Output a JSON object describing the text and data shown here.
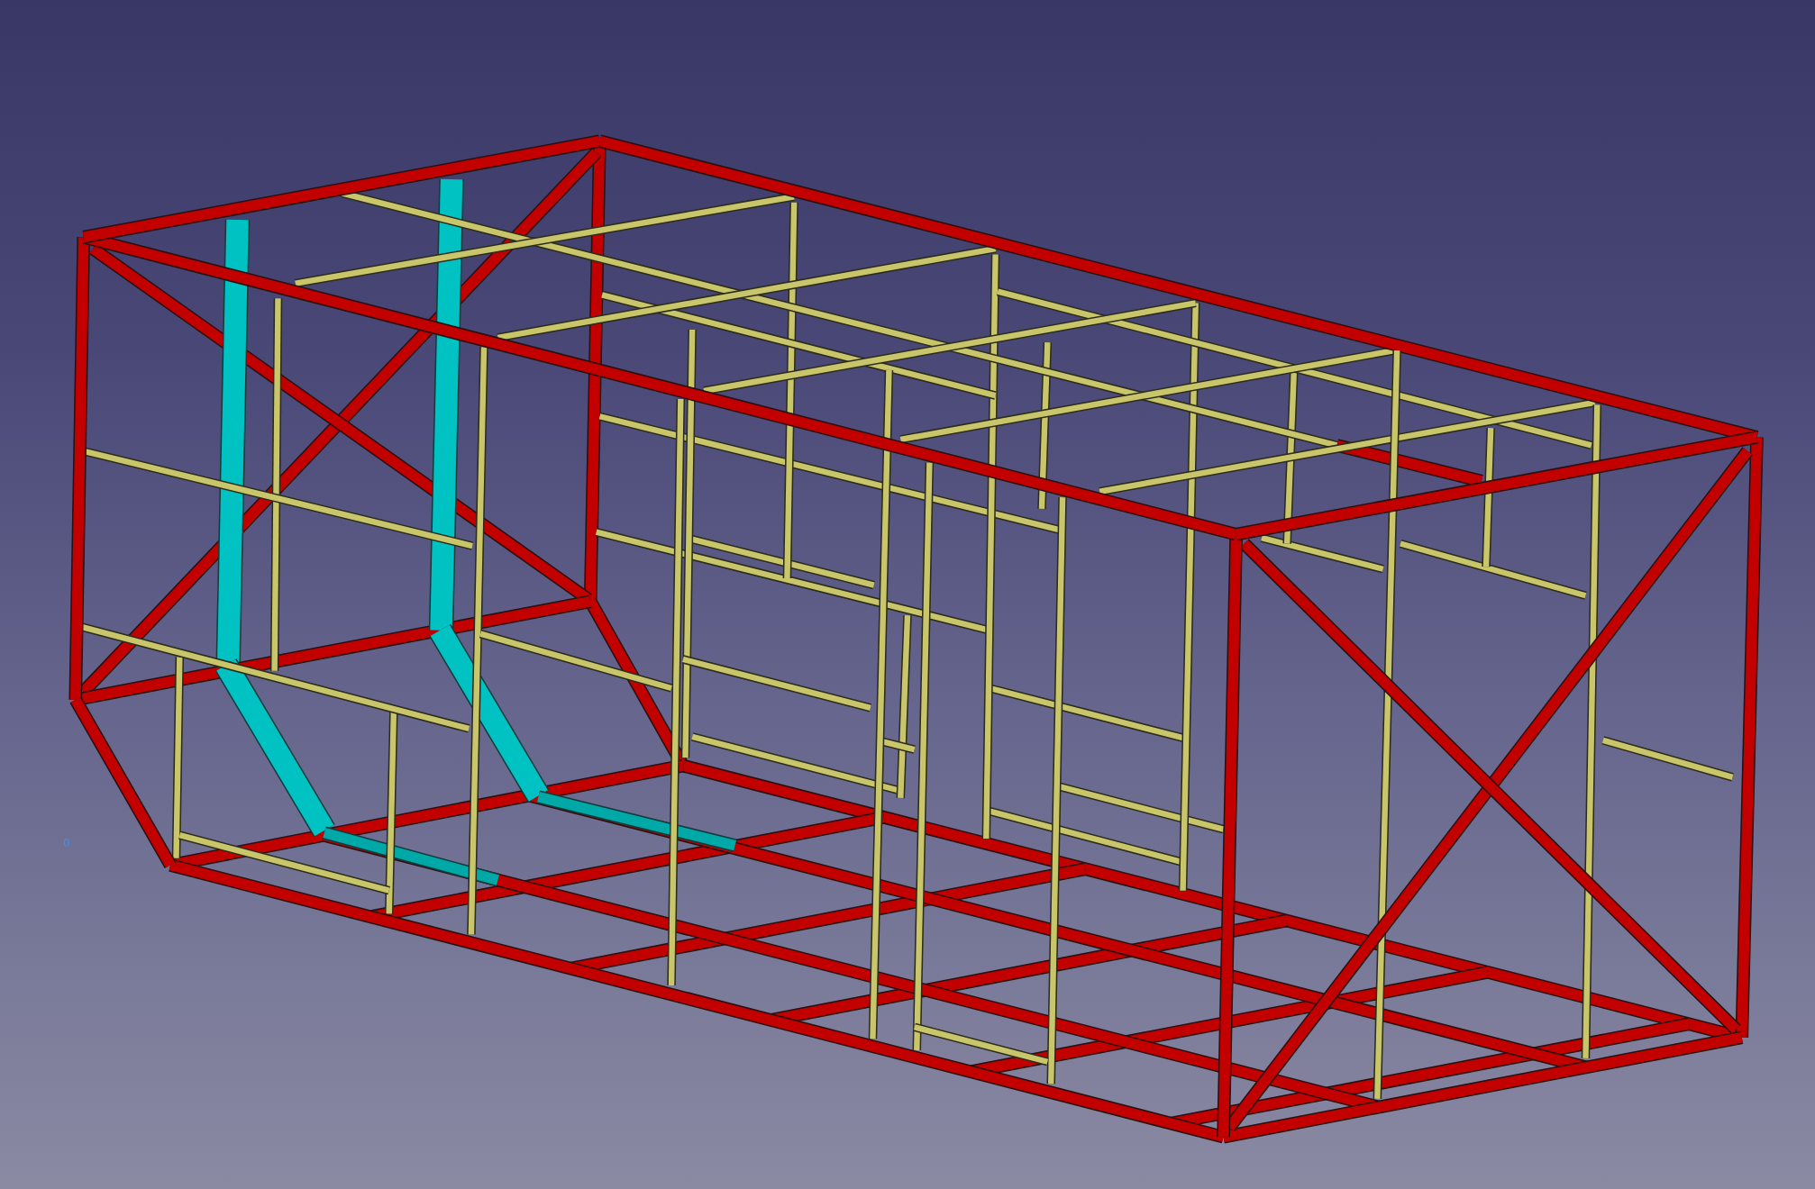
{
  "viewport": {
    "label": "0"
  }
}
